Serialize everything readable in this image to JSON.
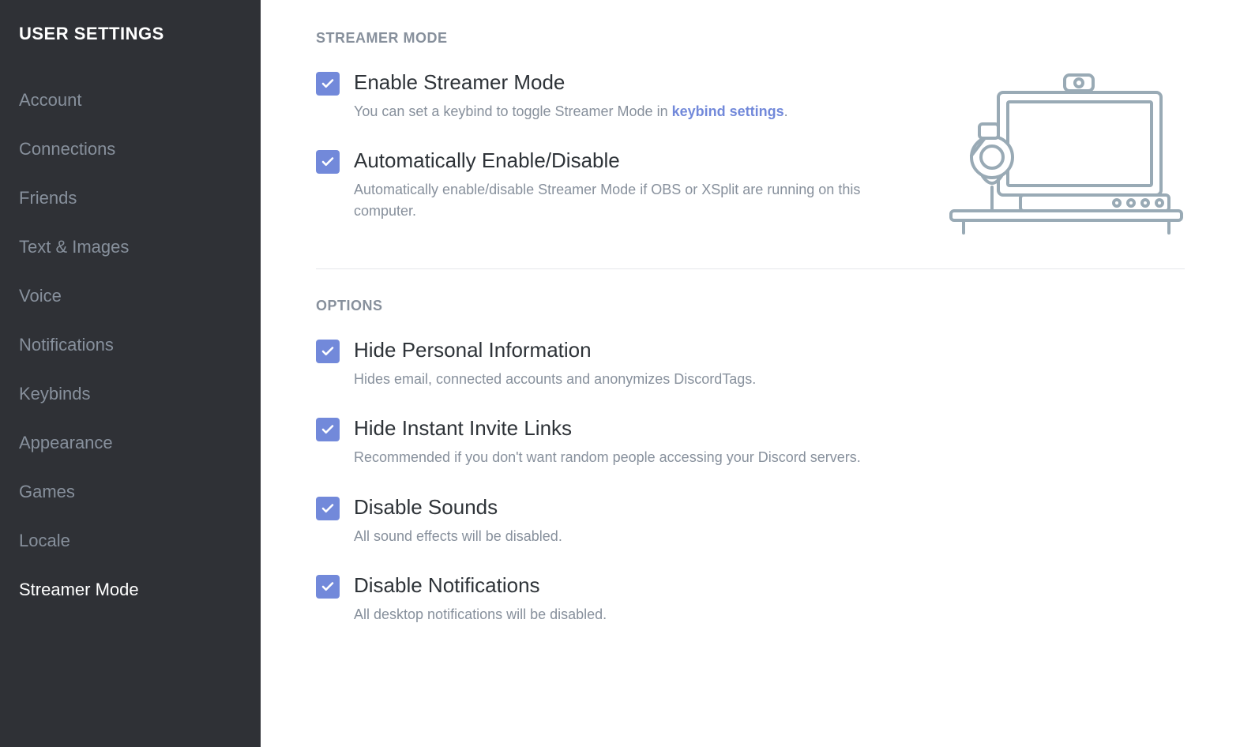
{
  "sidebar": {
    "title": "USER SETTINGS",
    "items": [
      {
        "label": "Account",
        "active": false
      },
      {
        "label": "Connections",
        "active": false
      },
      {
        "label": "Friends",
        "active": false
      },
      {
        "label": "Text & Images",
        "active": false
      },
      {
        "label": "Voice",
        "active": false
      },
      {
        "label": "Notifications",
        "active": false
      },
      {
        "label": "Keybinds",
        "active": false
      },
      {
        "label": "Appearance",
        "active": false
      },
      {
        "label": "Games",
        "active": false
      },
      {
        "label": "Locale",
        "active": false
      },
      {
        "label": "Streamer Mode",
        "active": true
      }
    ]
  },
  "main": {
    "section1": {
      "header": "STREAMER MODE",
      "items": [
        {
          "title": "Enable Streamer Mode",
          "desc_pre": "You can set a keybind to toggle Streamer Mode in ",
          "desc_link": "keybind settings",
          "desc_post": ".",
          "checked": true
        },
        {
          "title": "Automatically Enable/Disable",
          "desc": "Automatically enable/disable Streamer Mode if OBS or XSplit are running on this computer.",
          "checked": true
        }
      ]
    },
    "section2": {
      "header": "OPTIONS",
      "items": [
        {
          "title": "Hide Personal Information",
          "desc": "Hides email, connected accounts and anonymizes DiscordTags.",
          "checked": true
        },
        {
          "title": "Hide Instant Invite Links",
          "desc": "Recommended if you don't want random people accessing your Discord servers.",
          "checked": true
        },
        {
          "title": "Disable Sounds",
          "desc": "All sound effects will be disabled.",
          "checked": true
        },
        {
          "title": "Disable Notifications",
          "desc": "All desktop notifications will be disabled.",
          "checked": true
        }
      ]
    }
  }
}
